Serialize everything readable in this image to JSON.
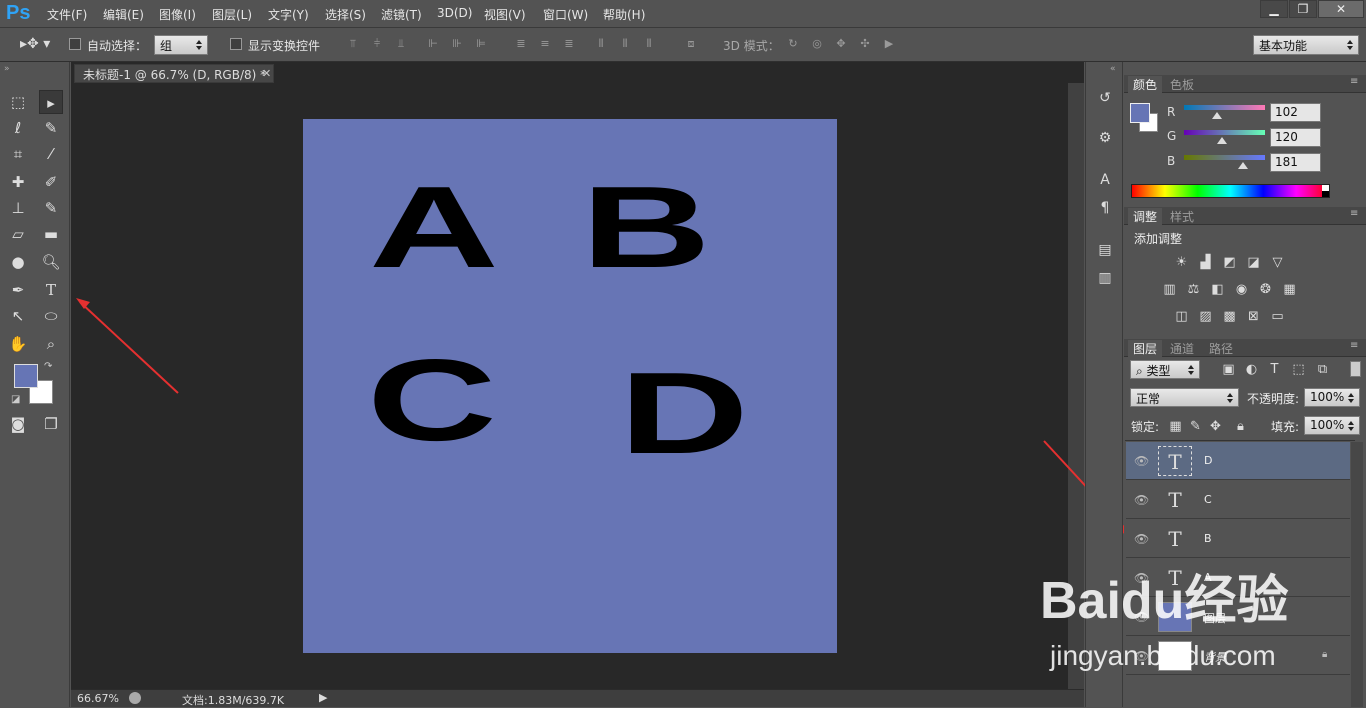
{
  "app": {
    "logo": "Ps"
  },
  "menu": [
    "文件(F)",
    "编辑(E)",
    "图像(I)",
    "图层(L)",
    "文字(Y)",
    "选择(S)",
    "滤镜(T)",
    "3D(D)",
    "视图(V)",
    "窗口(W)",
    "帮助(H)"
  ],
  "window_controls": {
    "minimize": "▁",
    "restore": "❐",
    "close": "✕"
  },
  "options": {
    "auto_select_label": "自动选择：",
    "auto_select_value": "组",
    "show_transform_label": "显示变换控件",
    "mode3d_label": "3D 模式：",
    "workspace": "基本功能"
  },
  "document": {
    "tab_title": "未标题-1 @ 66.7% (D, RGB/8) *",
    "bg_color": "#6775b5",
    "letters": [
      "A",
      "B",
      "C",
      "D"
    ]
  },
  "status": {
    "zoom": "66.67%",
    "doc_info": "文档:1.83M/639.7K"
  },
  "color_panel": {
    "tabs": [
      "颜色",
      "色板"
    ],
    "r_label": "R",
    "g_label": "G",
    "b_label": "B",
    "r": "102",
    "g": "120",
    "b": "181",
    "foreground": "#6675b5",
    "background": "#ffffff"
  },
  "adjust_panel": {
    "tabs": [
      "调整",
      "样式"
    ],
    "heading": "添加调整"
  },
  "layers_panel": {
    "tabs": [
      "图层",
      "通道",
      "路径"
    ],
    "filter_kind": "类型",
    "blend_mode": "正常",
    "opacity_label": "不透明度:",
    "opacity": "100%",
    "lock_label": "锁定:",
    "fill_label": "填充:",
    "fill": "100%",
    "layers": [
      {
        "name": "D",
        "type": "text",
        "selected": true
      },
      {
        "name": "C",
        "type": "text",
        "selected": false
      },
      {
        "name": "B",
        "type": "text",
        "selected": false
      },
      {
        "name": "A",
        "type": "text",
        "selected": false
      },
      {
        "name": "图层",
        "type": "pixel",
        "selected": false
      },
      {
        "name": "背景",
        "type": "background",
        "selected": false
      }
    ]
  },
  "watermark": {
    "text": "Baidu经验",
    "url": "jingyan.baidu.com"
  }
}
